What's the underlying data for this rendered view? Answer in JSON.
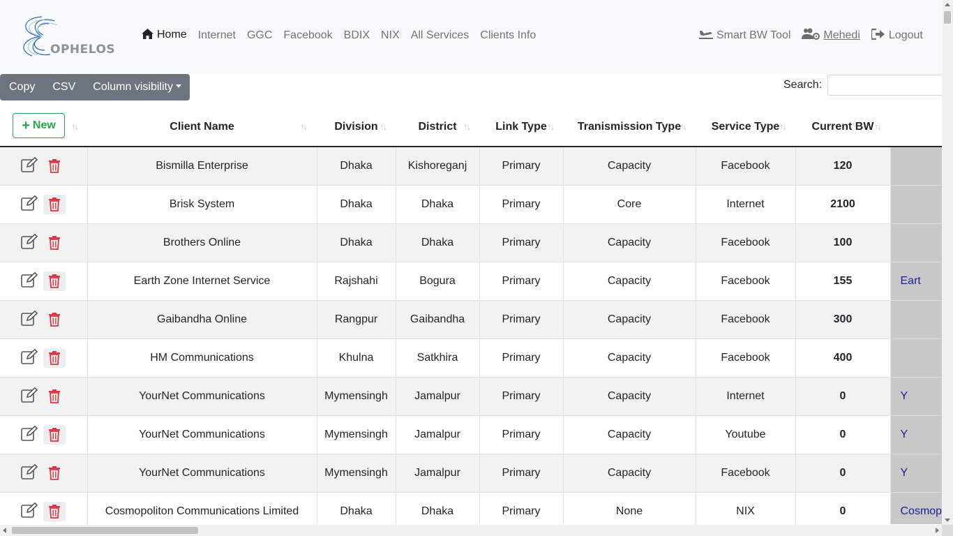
{
  "brand": {
    "logo_text": "OPHELOS"
  },
  "nav": {
    "left": [
      {
        "label": "Home",
        "icon": "home-icon"
      },
      {
        "label": "Internet"
      },
      {
        "label": "GGC"
      },
      {
        "label": "Facebook"
      },
      {
        "label": "BDIX"
      },
      {
        "label": "NIX"
      },
      {
        "label": "All Services"
      },
      {
        "label": "Clients Info"
      }
    ],
    "right": [
      {
        "label": "Smart BW Tool",
        "icon": "plane-icon"
      },
      {
        "label": "Mehedi",
        "icon": "users-cog-icon"
      },
      {
        "label": "Logout",
        "icon": "logout-icon"
      }
    ]
  },
  "toolbar": {
    "copy_label": "Copy",
    "csv_label": "CSV",
    "column_visibility_label": "Column visibility"
  },
  "search": {
    "label": "Search:",
    "value": ""
  },
  "table": {
    "new_button_label": "New",
    "headers": [
      "Client Name",
      "Division",
      "District",
      "Link Type",
      "Tranismission Type",
      "Service Type",
      "Current BW"
    ],
    "rows": [
      {
        "client": "Bismilla Enterprise",
        "division": "Dhaka",
        "district": "Kishoreganj",
        "link": "Primary",
        "transmission": "Capacity",
        "service": "Facebook",
        "bw": "120",
        "extra": ""
      },
      {
        "client": "Brisk System",
        "division": "Dhaka",
        "district": "Dhaka",
        "link": "Primary",
        "transmission": "Core",
        "service": "Internet",
        "bw": "2100",
        "extra": ""
      },
      {
        "client": "Brothers Online",
        "division": "Dhaka",
        "district": "Dhaka",
        "link": "Primary",
        "transmission": "Capacity",
        "service": "Facebook",
        "bw": "100",
        "extra": ""
      },
      {
        "client": "Earth Zone Internet Service",
        "division": "Rajshahi",
        "district": "Bogura",
        "link": "Primary",
        "transmission": "Capacity",
        "service": "Facebook",
        "bw": "155",
        "extra": "Eart"
      },
      {
        "client": "Gaibandha Online",
        "division": "Rangpur",
        "district": "Gaibandha",
        "link": "Primary",
        "transmission": "Capacity",
        "service": "Facebook",
        "bw": "300",
        "extra": ""
      },
      {
        "client": "HM Communications",
        "division": "Khulna",
        "district": "Satkhira",
        "link": "Primary",
        "transmission": "Capacity",
        "service": "Facebook",
        "bw": "400",
        "extra": ""
      },
      {
        "client": "YourNet Communications",
        "division": "Mymensingh",
        "district": "Jamalpur",
        "link": "Primary",
        "transmission": "Capacity",
        "service": "Internet",
        "bw": "0",
        "extra": "Y"
      },
      {
        "client": "YourNet Communications",
        "division": "Mymensingh",
        "district": "Jamalpur",
        "link": "Primary",
        "transmission": "Capacity",
        "service": "Youtube",
        "bw": "0",
        "extra": "Y"
      },
      {
        "client": "YourNet Communications",
        "division": "Mymensingh",
        "district": "Jamalpur",
        "link": "Primary",
        "transmission": "Capacity",
        "service": "Facebook",
        "bw": "0",
        "extra": "Y"
      },
      {
        "client": "Cosmopoliton Communications Limited",
        "division": "Dhaka",
        "district": "Dhaka",
        "link": "Primary",
        "transmission": "None",
        "service": "NIX",
        "bw": "0",
        "extra": "Cosmop"
      }
    ]
  },
  "colors": {
    "delete_red": "#dc3545",
    "new_green": "#28a745",
    "button_gray": "#6c757d",
    "navbar_bg": "#f8f9fa"
  }
}
